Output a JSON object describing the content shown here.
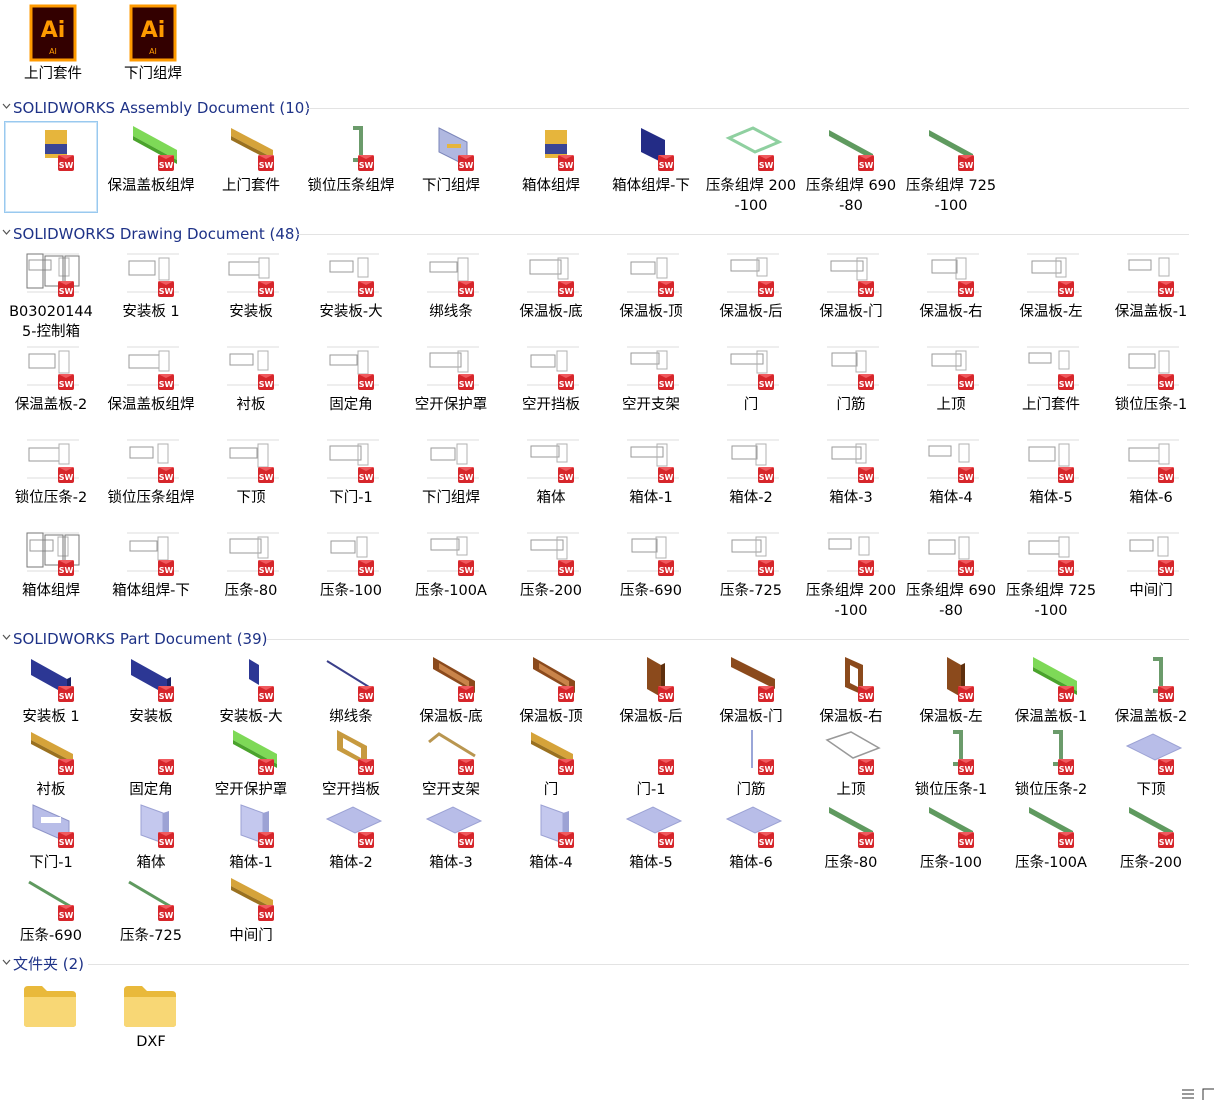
{
  "top_files": [
    {
      "label": "上门套件",
      "icon": "illustrator-file-icon"
    },
    {
      "label": "下门组焊",
      "icon": "illustrator-file-icon"
    }
  ],
  "groups": [
    {
      "title": "SOLIDWORKS Assembly Document (10)",
      "kind": "assembly",
      "items": [
        {
          "label": "",
          "preview": "yellow-block",
          "selected": true
        },
        {
          "label": "保温盖板组焊",
          "preview": "green-bar"
        },
        {
          "label": "上门套件",
          "preview": "yellow-bar"
        },
        {
          "label": "锁位压条组焊",
          "preview": "green-bracket"
        },
        {
          "label": "下门组焊",
          "preview": "blue-panel"
        },
        {
          "label": "箱体组焊",
          "preview": "yellow-block"
        },
        {
          "label": "箱体组焊-下",
          "preview": "navy-box"
        },
        {
          "label": "压条组焊 200-100",
          "preview": "green-frame"
        },
        {
          "label": "压条组焊 690-80",
          "preview": "green-line"
        },
        {
          "label": "压条组焊 725-100",
          "preview": "green-line"
        }
      ]
    },
    {
      "title": "SOLIDWORKS Drawing Document (48)",
      "kind": "drawing",
      "items": [
        {
          "label": "B030201445-控制箱"
        },
        {
          "label": "安装板 1"
        },
        {
          "label": "安装板"
        },
        {
          "label": "安装板-大"
        },
        {
          "label": "绑线条"
        },
        {
          "label": "保温板-底"
        },
        {
          "label": "保温板-顶"
        },
        {
          "label": "保温板-后"
        },
        {
          "label": "保温板-门"
        },
        {
          "label": "保温板-右"
        },
        {
          "label": "保温板-左"
        },
        {
          "label": "保温盖板-1"
        },
        {
          "label": "保温盖板-2"
        },
        {
          "label": "保温盖板组焊"
        },
        {
          "label": "衬板"
        },
        {
          "label": "固定角"
        },
        {
          "label": "空开保护罩"
        },
        {
          "label": "空开挡板"
        },
        {
          "label": "空开支架"
        },
        {
          "label": "门"
        },
        {
          "label": "门筋"
        },
        {
          "label": "上顶"
        },
        {
          "label": "上门套件"
        },
        {
          "label": "锁位压条-1"
        },
        {
          "label": "锁位压条-2"
        },
        {
          "label": "锁位压条组焊"
        },
        {
          "label": "下顶"
        },
        {
          "label": "下门-1"
        },
        {
          "label": "下门组焊"
        },
        {
          "label": "箱体"
        },
        {
          "label": "箱体-1"
        },
        {
          "label": "箱体-2"
        },
        {
          "label": "箱体-3"
        },
        {
          "label": "箱体-4"
        },
        {
          "label": "箱体-5"
        },
        {
          "label": "箱体-6"
        },
        {
          "label": "箱体组焊"
        },
        {
          "label": "箱体组焊-下"
        },
        {
          "label": "压条-80"
        },
        {
          "label": "压条-100"
        },
        {
          "label": "压条-100A"
        },
        {
          "label": "压条-200"
        },
        {
          "label": "压条-690"
        },
        {
          "label": "压条-725"
        },
        {
          "label": "压条组焊 200-100"
        },
        {
          "label": "压条组焊 690-80"
        },
        {
          "label": "压条组焊 725-100"
        },
        {
          "label": "中间门"
        }
      ]
    },
    {
      "title": "SOLIDWORKS Part Document (39)",
      "kind": "part",
      "items": [
        {
          "label": "安装板 1",
          "preview": "navy-plate"
        },
        {
          "label": "安装板",
          "preview": "navy-plate"
        },
        {
          "label": "安装板-大",
          "preview": "navy-small"
        },
        {
          "label": "绑线条",
          "preview": "navy-line"
        },
        {
          "label": "保温板-底",
          "preview": "brown-tray"
        },
        {
          "label": "保温板-顶",
          "preview": "brown-tray"
        },
        {
          "label": "保温板-后",
          "preview": "brown-board"
        },
        {
          "label": "保温板-门",
          "preview": "brown-bar"
        },
        {
          "label": "保温板-右",
          "preview": "brown-frame"
        },
        {
          "label": "保温板-左",
          "preview": "brown-board"
        },
        {
          "label": "保温盖板-1",
          "preview": "green-bar"
        },
        {
          "label": "保温盖板-2",
          "preview": "green-bracket"
        },
        {
          "label": "衬板",
          "preview": "yellow-bar"
        },
        {
          "label": "固定角",
          "preview": "none"
        },
        {
          "label": "空开保护罩",
          "preview": "green-bar"
        },
        {
          "label": "空开挡板",
          "preview": "yellow-frame"
        },
        {
          "label": "空开支架",
          "preview": "yellow-line"
        },
        {
          "label": "门",
          "preview": "yellow-bar"
        },
        {
          "label": "门-1",
          "preview": "none"
        },
        {
          "label": "门筋",
          "preview": "blue-line"
        },
        {
          "label": "上顶",
          "preview": "outline-plate"
        },
        {
          "label": "锁位压条-1",
          "preview": "green-bracket"
        },
        {
          "label": "锁位压条-2",
          "preview": "green-bracket"
        },
        {
          "label": "下顶",
          "preview": "lilac-plate"
        },
        {
          "label": "下门-1",
          "preview": "lilac-panel"
        },
        {
          "label": "箱体",
          "preview": "lilac-box"
        },
        {
          "label": "箱体-1",
          "preview": "lilac-box"
        },
        {
          "label": "箱体-2",
          "preview": "lilac-plate"
        },
        {
          "label": "箱体-3",
          "preview": "lilac-plate"
        },
        {
          "label": "箱体-4",
          "preview": "lilac-box"
        },
        {
          "label": "箱体-5",
          "preview": "lilac-plate"
        },
        {
          "label": "箱体-6",
          "preview": "lilac-plate"
        },
        {
          "label": "压条-80",
          "preview": "green-line"
        },
        {
          "label": "压条-100",
          "preview": "green-line"
        },
        {
          "label": "压条-100A",
          "preview": "green-line"
        },
        {
          "label": "压条-200",
          "preview": "green-line"
        },
        {
          "label": "压条-690",
          "preview": "green-thin"
        },
        {
          "label": "压条-725",
          "preview": "green-thin"
        },
        {
          "label": "中间门",
          "preview": "yellow-bar"
        }
      ]
    },
    {
      "title": "文件夹 (2)",
      "kind": "folder",
      "items": [
        {
          "label": ""
        },
        {
          "label": "DXF"
        }
      ]
    }
  ],
  "colors": {
    "group_title": "#1e3287",
    "selection_border": "#99c9ef",
    "sw_badge": "#d6262b",
    "folder": "#f8d775"
  },
  "status_icons": [
    "details-view-icon",
    "large-icons-view-icon"
  ]
}
